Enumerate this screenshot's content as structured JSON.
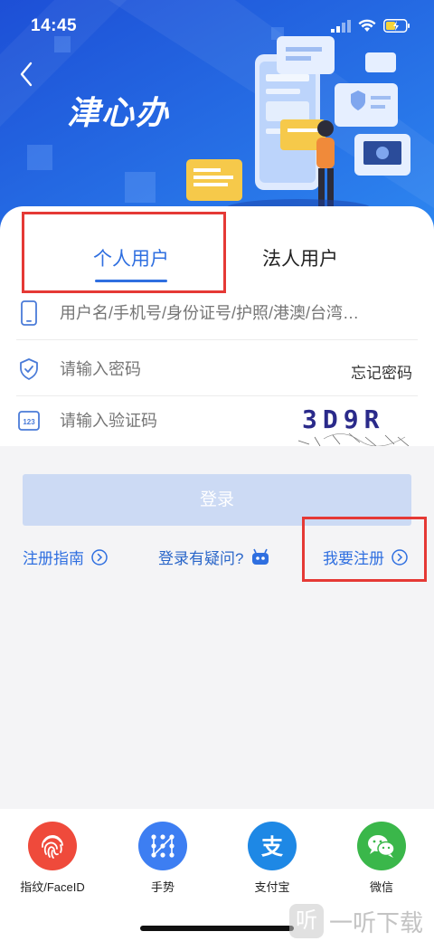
{
  "status": {
    "time": "14:45"
  },
  "header": {
    "logo": "津心办"
  },
  "tabs": [
    {
      "label": "个人用户",
      "active": true
    },
    {
      "label": "法人用户",
      "active": false
    }
  ],
  "form": {
    "username_placeholder": "用户名/手机号/身份证号/护照/港澳/台湾…",
    "password_placeholder": "请输入密码",
    "forgot_label": "忘记密码",
    "captcha_placeholder": "请输入验证码",
    "captcha_text": "3D9R",
    "login_label": "登录"
  },
  "links": {
    "guide": "注册指南",
    "question": "登录有疑问?",
    "register": "我要注册"
  },
  "login_options": [
    {
      "label": "指纹/FaceID",
      "icon": "fingerprint-icon",
      "color": "#ef4a3b"
    },
    {
      "label": "手势",
      "icon": "gesture-icon",
      "color": "#3d7ef2"
    },
    {
      "label": "支付宝",
      "icon": "alipay-icon",
      "color": "#1e88e5"
    },
    {
      "label": "微信",
      "icon": "wechat-icon",
      "color": "#3ab74a"
    }
  ],
  "watermark": {
    "icon_char": "听",
    "text": "一听下载"
  },
  "colors": {
    "accent": "#2f6fe0",
    "highlight": "#e53935"
  }
}
